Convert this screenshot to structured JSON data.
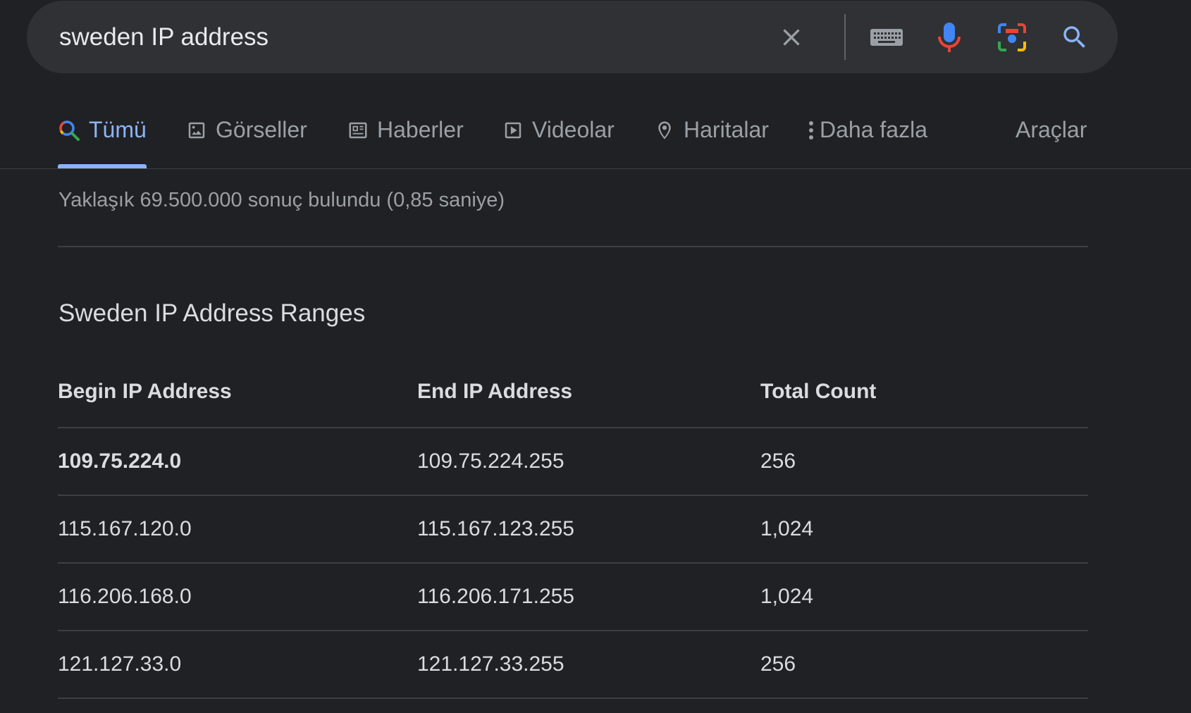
{
  "search": {
    "query": "sweden IP address"
  },
  "search_icons": {
    "clear": "close-icon",
    "keyboard": "keyboard-icon",
    "voice": "mic-icon",
    "lens": "lens-icon",
    "submit": "search-icon"
  },
  "colors": {
    "background": "#202124",
    "search_bar": "#303134",
    "active_tab": "#8ab4f8",
    "mic_blue": "#4285f4",
    "mic_red": "#ea4335",
    "lens_green": "#34a853",
    "lens_yellow": "#fbbc04"
  },
  "tabs": [
    {
      "label": "Tümü",
      "icon": "search-icon",
      "active": true
    },
    {
      "label": "Görseller",
      "icon": "image-icon",
      "active": false
    },
    {
      "label": "Haberler",
      "icon": "news-icon",
      "active": false
    },
    {
      "label": "Videolar",
      "icon": "play-icon",
      "active": false
    },
    {
      "label": "Haritalar",
      "icon": "map-pin-icon",
      "active": false
    },
    {
      "label": "Daha fazla",
      "icon": "more-vert-icon",
      "active": false
    }
  ],
  "tools_label": "Araçlar",
  "result_stats": "Yaklaşık 69.500.000 sonuç bulundu (0,85 saniye)",
  "snippet": {
    "title": "Sweden IP Address Ranges",
    "columns": [
      "Begin IP Address",
      "End IP Address",
      "Total Count"
    ],
    "rows": [
      [
        "109.75.224.0",
        "109.75.224.255",
        "256"
      ],
      [
        "115.167.120.0",
        "115.167.123.255",
        "1,024"
      ],
      [
        "116.206.168.0",
        "116.206.171.255",
        "1,024"
      ],
      [
        "121.127.33.0",
        "121.127.33.255",
        "256"
      ]
    ]
  }
}
